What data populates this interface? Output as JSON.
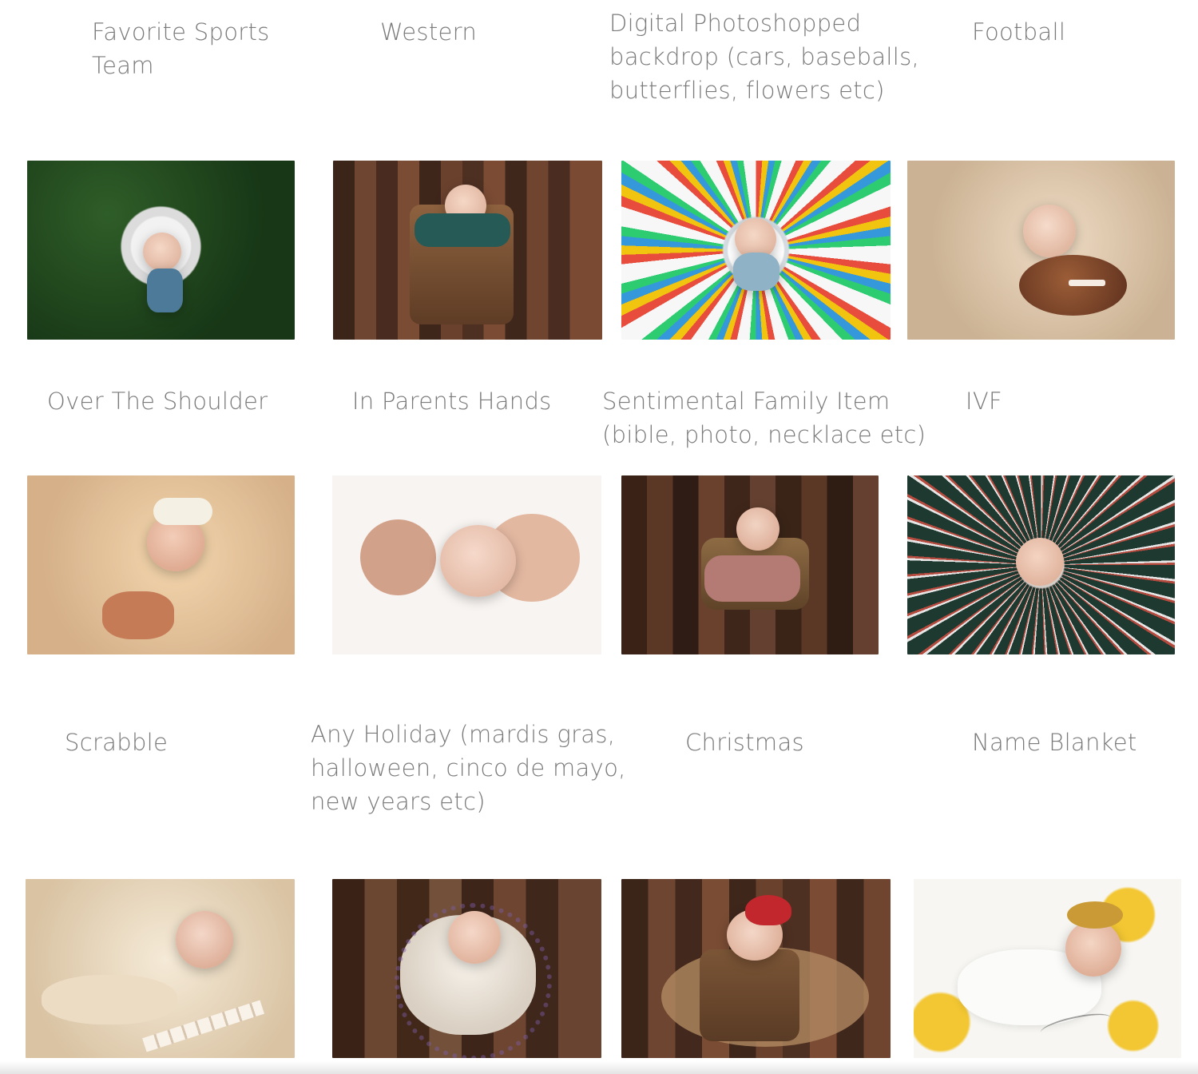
{
  "gallery": {
    "row1": {
      "captions": [
        "Favorite Sports\nTeam",
        "Western",
        "Digital Photoshopped\nbackdrop (cars, baseballs,\nbutterflies, flowers etc)",
        "Football"
      ]
    },
    "row2": {
      "captions": [
        "Over The Shoulder",
        "In Parents Hands",
        "Sentimental Family Item\n(bible, photo, necklace etc)",
        "IVF"
      ]
    },
    "row3": {
      "captions": [
        "Scrabble",
        "Any Holiday (mardis gras,\nhalloween, cinco de mayo,\nnew years etc)",
        "Christmas",
        "Name Blanket"
      ]
    }
  },
  "colors": {
    "caption_text": "#7a7a7a",
    "background": "#ffffff"
  }
}
